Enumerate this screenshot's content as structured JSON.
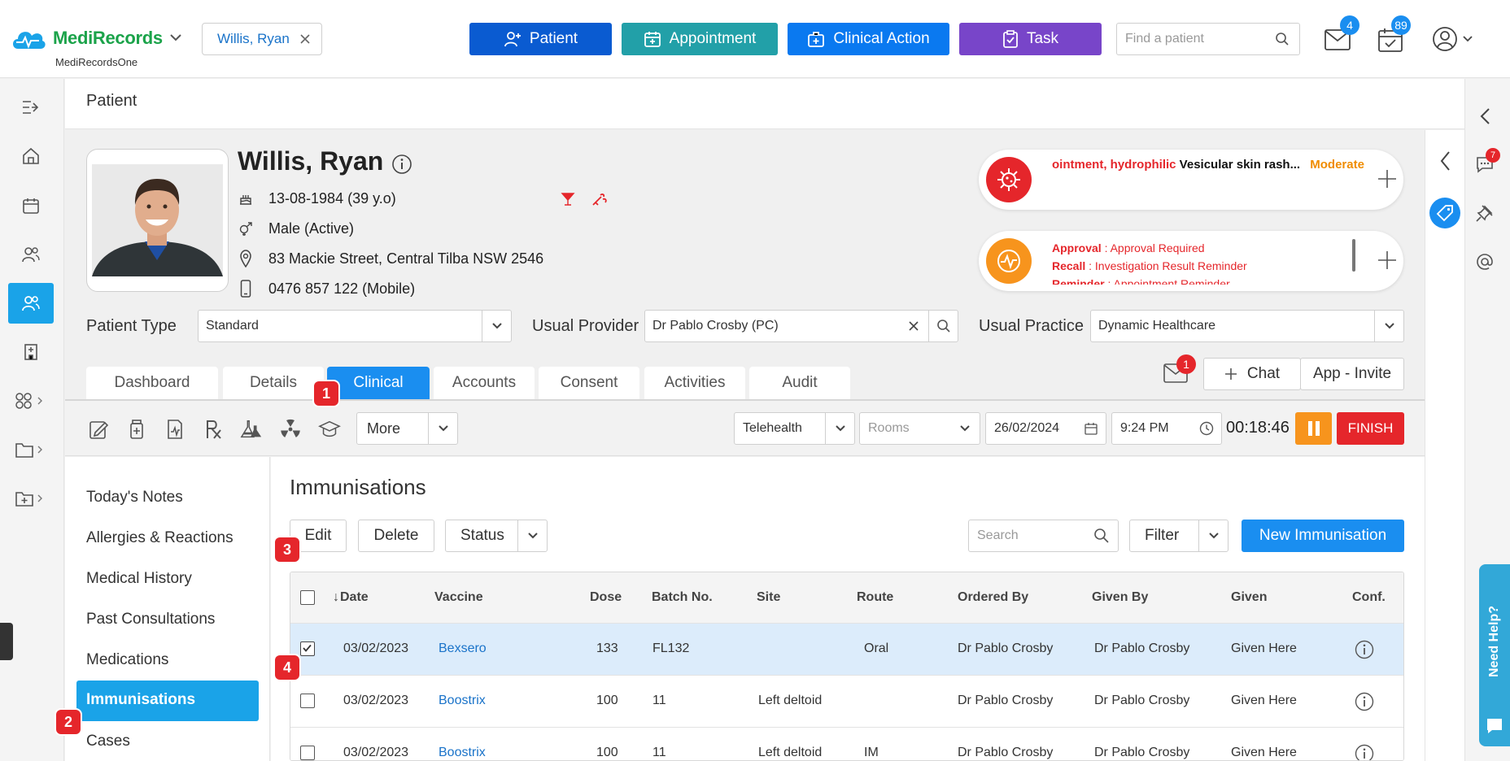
{
  "app": {
    "name": "MediRecords",
    "subtitle": "MediRecordsOne",
    "open_patient_chip": "Willis, Ryan"
  },
  "topbar": {
    "patient_btn": "Patient",
    "appointment_btn": "Appointment",
    "clinical_action_btn": "Clinical Action",
    "task_btn": "Task",
    "find_placeholder": "Find a patient",
    "mail_badge": "4",
    "calendar_badge": "89",
    "colors": {
      "patient": "#0a5bd1",
      "appointment": "#22a0a8",
      "clinical": "#0a79f0",
      "task": "#7845c9"
    }
  },
  "breadcrumb": "Patient",
  "patient": {
    "name": "Willis, Ryan",
    "dob": "13-08-1984 (39 y.o)",
    "gender": "Male (Active)",
    "address": "83 Mackie Street, Central Tilba NSW 2546",
    "phone": "0476 857 122 (Mobile)"
  },
  "alerts": {
    "allergy_name": "ointment, hydrophilic",
    "allergy_reaction": "Vesicular skin rash...",
    "allergy_severity": "Moderate",
    "reminders": [
      {
        "key": "Approval",
        "value": "Approval Required"
      },
      {
        "key": "Recall",
        "value": "Investigation Result Reminder"
      },
      {
        "key": "Reminder",
        "value": "Appointment Reminder"
      }
    ]
  },
  "fields": {
    "patient_type_label": "Patient Type",
    "patient_type_value": "Standard",
    "usual_provider_label": "Usual Provider",
    "usual_provider_value": "Dr Pablo Crosby (PC)",
    "usual_practice_label": "Usual Practice",
    "usual_practice_value": "Dynamic Healthcare"
  },
  "tabs": [
    "Dashboard",
    "Details",
    "Clinical",
    "Accounts",
    "Consent",
    "Activities",
    "Audit"
  ],
  "active_tab": "Clinical",
  "tab_actions": {
    "mail_badge": "1",
    "chat": "Chat",
    "app_invite": "App - Invite"
  },
  "toolbar": {
    "more": "More",
    "mode": "Telehealth",
    "rooms_placeholder": "Rooms",
    "date": "26/02/2024",
    "time": "9:24 PM",
    "timer": "00:18:46",
    "finish": "FINISH"
  },
  "submenu": [
    "Today's Notes",
    "Allergies & Reactions",
    "Medical History",
    "Past Consultations",
    "Medications",
    "Immunisations",
    "Cases"
  ],
  "immunisations": {
    "title": "Immunisations",
    "edit": "Edit",
    "delete": "Delete",
    "status": "Status",
    "search_placeholder": "Search",
    "filter": "Filter",
    "new": "New Immunisation",
    "columns": [
      "Date",
      "Vaccine",
      "Dose",
      "Batch No.",
      "Site",
      "Route",
      "Ordered By",
      "Given By",
      "Given",
      "Conf."
    ],
    "rows": [
      {
        "date": "03/02/2023",
        "vaccine": "Bexsero",
        "dose": "133",
        "batch": "FL132",
        "site": "",
        "route": "Oral",
        "ordered": "Dr Pablo Crosby",
        "given_by": "Dr Pablo Crosby",
        "given": "Given Here"
      },
      {
        "date": "03/02/2023",
        "vaccine": "Boostrix",
        "dose": "100",
        "batch": "11",
        "site": "Left deltoid",
        "route": "",
        "ordered": "Dr Pablo Crosby",
        "given_by": "Dr Pablo Crosby",
        "given": "Given Here"
      },
      {
        "date": "03/02/2023",
        "vaccine": "Boostrix",
        "dose": "100",
        "batch": "11",
        "site": "Left deltoid",
        "route": "IM",
        "ordered": "Dr Pablo Crosby",
        "given_by": "Dr Pablo Crosby",
        "given": "Given Here"
      }
    ]
  },
  "steps": [
    "1",
    "2",
    "3",
    "4"
  ],
  "right_rail": {
    "messages_badge": "7"
  },
  "help": "Need Help?"
}
